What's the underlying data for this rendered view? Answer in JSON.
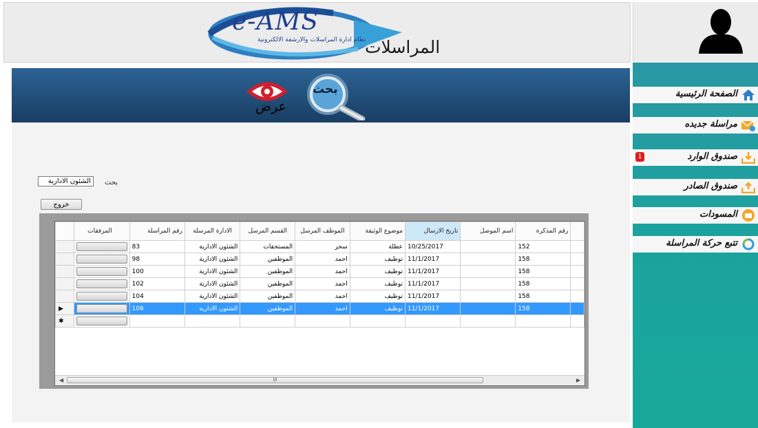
{
  "header": {
    "logo_text": "e-AMS",
    "logo_subtitle": "نظام ادارة المراسلات والارشفة الالكترونية",
    "app_title": "المراسلات"
  },
  "banner": {
    "icon_label_search": "بحث",
    "icon_label_view": "عرض"
  },
  "search": {
    "value": "الشئون الادارية",
    "label": "بحث"
  },
  "exit_label": "خروج",
  "grid": {
    "columns": [
      "المرفقات",
      "رقم المراسلة",
      "الادارة المرسلة",
      "القسم المرسل",
      "الموظف المرسل",
      "موضوع الوثيقة",
      "تاريخ الارسال",
      "اسم الموصل",
      "رقم المذكرة"
    ],
    "rows": [
      {
        "msg_no": "83",
        "dept": "الشئون الادارية",
        "section": "المستحقات",
        "employee": "سحر",
        "subject": "عطلة",
        "date": "10/25/2017",
        "courier": "",
        "memo_no": "152"
      },
      {
        "msg_no": "98",
        "dept": "الشئون الادارية",
        "section": "الموظفين",
        "employee": "احمد",
        "subject": "توظيف",
        "date": "11/1/2017",
        "courier": "",
        "memo_no": "158"
      },
      {
        "msg_no": "100",
        "dept": "الشئون الادارية",
        "section": "الموظفين",
        "employee": "احمد",
        "subject": "توظيف",
        "date": "11/1/2017",
        "courier": "",
        "memo_no": "158"
      },
      {
        "msg_no": "102",
        "dept": "الشئون الادارية",
        "section": "الموظفين",
        "employee": "احمد",
        "subject": "توظيف",
        "date": "11/1/2017",
        "courier": "",
        "memo_no": "158"
      },
      {
        "msg_no": "104",
        "dept": "الشئون الادارية",
        "section": "الموظفين",
        "employee": "احمد",
        "subject": "توظيف",
        "date": "11/1/2017",
        "courier": "",
        "memo_no": "158"
      },
      {
        "msg_no": "106",
        "dept": "الشئون الادارية",
        "section": "الموظفين",
        "employee": "احمد",
        "subject": "توظيف",
        "date": "11/1/2017",
        "courier": "",
        "memo_no": "158"
      }
    ],
    "current_row_marker": "▶",
    "new_row_marker": "✱",
    "scroll_thumb_text": "III"
  },
  "sidebar": {
    "items": [
      {
        "label": "الصفحة الرئيسية",
        "icon": "home-icon"
      },
      {
        "label": "مراسلة جديده",
        "icon": "envelope-plus-icon"
      },
      {
        "label": "صندوق الوارد",
        "icon": "inbox-icon",
        "badge": "1"
      },
      {
        "label": "صندوق الصادر",
        "icon": "outbox-icon"
      },
      {
        "label": "المسودات",
        "icon": "drafts-icon"
      },
      {
        "label": "تتبع حركة المراسلة",
        "icon": "refresh-icon"
      }
    ]
  },
  "colors": {
    "banner_top": "#2c6394",
    "sidebar": "#1aa39d",
    "selection": "#3399ff",
    "badge": "#d92020"
  }
}
